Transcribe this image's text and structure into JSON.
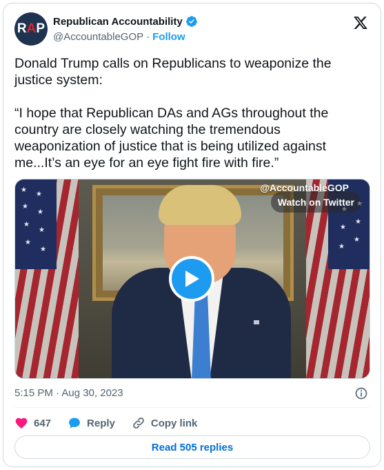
{
  "account": {
    "display_name": "Republican Accountability",
    "handle": "@AccountableGOP",
    "separator": "·",
    "follow_label": "Follow",
    "avatar_letters": {
      "r": "R",
      "a": "A",
      "p": "P"
    }
  },
  "tweet": {
    "paragraphs": [
      "Donald Trump calls on Republicans to weaponize the justice system:",
      "“I hope that Republican DAs and AGs throughout the country are closely watching the tremendous weaponization of justice that is being utilized against me...It’s an eye for an eye fight fire with fire.”"
    ]
  },
  "video": {
    "watermark": "@AccountableGOP",
    "watch_label": "Watch on Twitter"
  },
  "meta": {
    "timestamp": "5:15 PM · Aug 30, 2023"
  },
  "actions": {
    "likes": "647",
    "reply_label": "Reply",
    "copy_link_label": "Copy link"
  },
  "read_replies_label": "Read 505 replies",
  "colors": {
    "accent": "#1d9bf0",
    "like": "#f91880",
    "link": "#006fd6",
    "muted": "#536471"
  }
}
